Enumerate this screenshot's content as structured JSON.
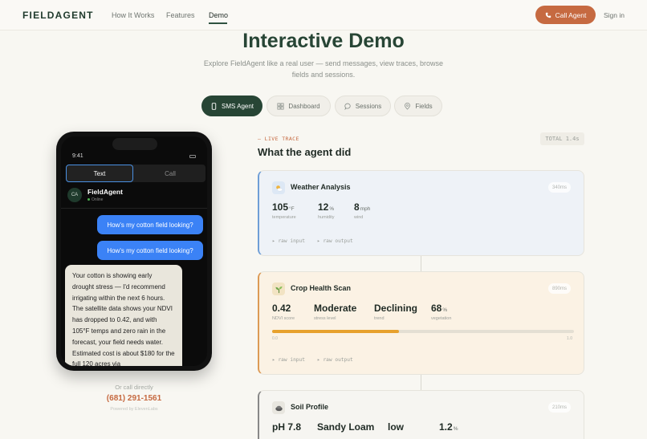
{
  "nav": {
    "logo": "FIELDAGENT",
    "links": [
      "How It Works",
      "Features",
      "Demo"
    ],
    "active": "Demo",
    "call_button": "Call Agent",
    "signin": "Sign in"
  },
  "hero": {
    "title": "Interactive Demo",
    "subtitle": "Explore FieldAgent like a real user — send messages, view traces, browse fields and sessions."
  },
  "tabs": [
    {
      "label": "SMS Agent",
      "icon": "phone-icon",
      "active": true
    },
    {
      "label": "Dashboard",
      "icon": "grid-icon",
      "active": false
    },
    {
      "label": "Sessions",
      "icon": "chat-icon",
      "active": false
    },
    {
      "label": "Fields",
      "icon": "pin-icon",
      "active": false
    }
  ],
  "phone": {
    "time": "9:41",
    "toggle_text": "Text",
    "toggle_call": "Call",
    "avatar": "CA",
    "agent_name": "FieldAgent",
    "agent_status": "Online",
    "messages": [
      {
        "from": "user",
        "text": "How's my cotton field looking?"
      },
      {
        "from": "user",
        "text": "How's my cotton field looking?"
      },
      {
        "from": "agent",
        "text": "Your cotton is showing early drought stress — I'd recommend irrigating within the next 6 hours. The satellite data shows your NDVI has dropped to 0.42, and with 105°F temps and zero rain in the forecast, your field needs water. Estimated cost is about $180 for the full 120 acres via"
      }
    ],
    "or_call": "Or call directly",
    "number": "(681) 291-1561",
    "powered": "Powered by ElevenLabs"
  },
  "trace": {
    "live_label": "— LIVE TRACE",
    "title": "What the agent did",
    "total": "TOTAL 1.4s",
    "cards": {
      "weather": {
        "title": "Weather Analysis",
        "ms": "340ms",
        "icon": "sun-cloud-icon",
        "metrics": [
          {
            "value": "105",
            "unit": "°F",
            "label": "temperature"
          },
          {
            "value": "12",
            "unit": "%",
            "label": "humidity"
          },
          {
            "value": "8",
            "unit": "mph",
            "label": "wind"
          }
        ],
        "raw_input": "raw input",
        "raw_output": "raw output"
      },
      "crop": {
        "title": "Crop Health Scan",
        "ms": "890ms",
        "icon": "sprout-icon",
        "metrics": [
          {
            "value": "0.42",
            "unit": "",
            "label": "NDVI score"
          },
          {
            "value": "Moderate",
            "unit": "",
            "label": "stress level"
          },
          {
            "value": "Declining",
            "unit": "",
            "label": "trend"
          },
          {
            "value": "68",
            "unit": "%",
            "label": "vegetation"
          }
        ],
        "ndvi_fraction": 0.42,
        "bar_min": "0.0",
        "bar_max": "1.0",
        "raw_input": "raw input",
        "raw_output": "raw output"
      },
      "soil": {
        "title": "Soil Profile",
        "ms": "210ms",
        "icon": "soil-icon",
        "metrics": [
          {
            "value": "pH 7.8",
            "unit": ""
          },
          {
            "value": "Sandy Loam",
            "unit": ""
          },
          {
            "value": "low",
            "unit": ""
          },
          {
            "value": "1.2",
            "unit": "%"
          }
        ]
      }
    }
  },
  "colors": {
    "brand_green": "#274535",
    "accent_orange": "#c66a41",
    "sms_blue": "#3b82f6",
    "weather_accent": "#6f9ed6",
    "crop_accent": "#dc9a55",
    "ndvi_bar": "#e7a12d"
  }
}
